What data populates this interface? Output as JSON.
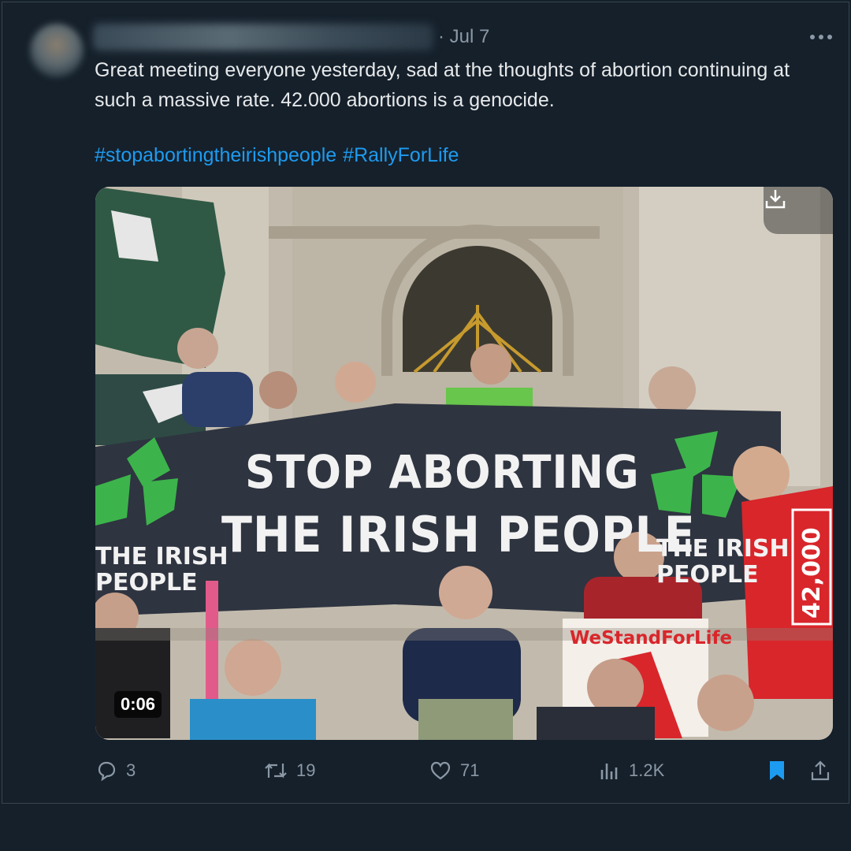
{
  "post": {
    "timestamp": "· Jul 7",
    "text": "Great meeting everyone yesterday, sad at the thoughts of abortion continuing at such a massive rate. 42.000 abortions is a genocide.",
    "hashtags": [
      "#stopabortingtheirishpeople",
      "#RallyForLife"
    ]
  },
  "media": {
    "type": "video",
    "duration": "0:06",
    "banner_line1": "STOP ABORTING",
    "banner_line2": "THE IRISH PEOPLE",
    "logo_left_line1": "THE IRISH",
    "logo_left_line2": "PEOPLE",
    "logo_right_line1": "THE IRISH",
    "logo_right_line2": "PEOPLE",
    "sign_text": "WeStandForLife",
    "counter_text": "42,000"
  },
  "actions": {
    "replies": "3",
    "reposts": "19",
    "likes": "71",
    "views": "1.2K"
  },
  "colors": {
    "background": "#15202b",
    "accent": "#1d9bf0",
    "muted": "#8b98a5",
    "banner": "#2e3440",
    "shamrock": "#3cb44b"
  },
  "icons": [
    "more-icon",
    "download-icon",
    "reply-icon",
    "repost-icon",
    "like-icon",
    "views-icon",
    "bookmark-icon",
    "share-icon"
  ]
}
